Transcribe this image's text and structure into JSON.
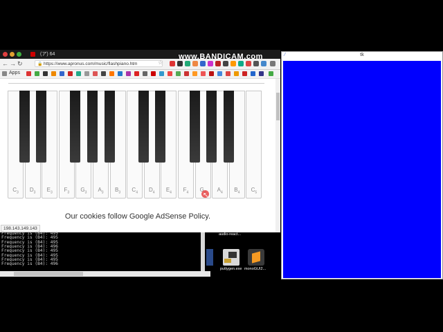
{
  "browser": {
    "tab_label": "(ア) 64",
    "url": "https://www.apronus.com/music/flashpiano.htm",
    "bookmarks_apps": "Apps"
  },
  "recorder": {
    "watermark": "www.BANDICAM.com"
  },
  "piano": {
    "white_keys": [
      {
        "note": "C",
        "oct": "3"
      },
      {
        "note": "D",
        "oct": "3"
      },
      {
        "note": "E",
        "oct": "3"
      },
      {
        "note": "F",
        "oct": "3"
      },
      {
        "note": "G",
        "oct": "3"
      },
      {
        "note": "A",
        "oct": "3"
      },
      {
        "note": "B",
        "oct": "3"
      },
      {
        "note": "C",
        "oct": "4"
      },
      {
        "note": "D",
        "oct": "4"
      },
      {
        "note": "E",
        "oct": "4"
      },
      {
        "note": "F",
        "oct": "4"
      },
      {
        "note": "G",
        "oct": "4"
      },
      {
        "note": "A",
        "oct": "4"
      },
      {
        "note": "B",
        "oct": "4"
      },
      {
        "note": "C",
        "oct": "5"
      }
    ],
    "pressed_key": "G4"
  },
  "page": {
    "cookies_text": "Our cookies follow Google AdSense Policy.",
    "ip_text": "198.143.149.143"
  },
  "terminal": {
    "lines": [
      "Frequency is (B4): 495",
      "Frequency is (B4): 495",
      "Frequency is (B4): 495",
      "Frequency is (B4): 496",
      "Frequency is (B4): 495",
      "Frequency is (B4): 495",
      "Frequency is (B4): 495",
      "Frequency is (B4): 496"
    ]
  },
  "desktop": {
    "icons": [
      {
        "label": "audio-react...",
        "icon": "file-icon"
      },
      {
        "label": "puttygen.exe",
        "icon": "puttygen-icon"
      },
      {
        "label": "monoGUI2...",
        "icon": "sublime-icon"
      }
    ]
  },
  "tk_window": {
    "title": "tk",
    "canvas_color": "#0000ff"
  }
}
